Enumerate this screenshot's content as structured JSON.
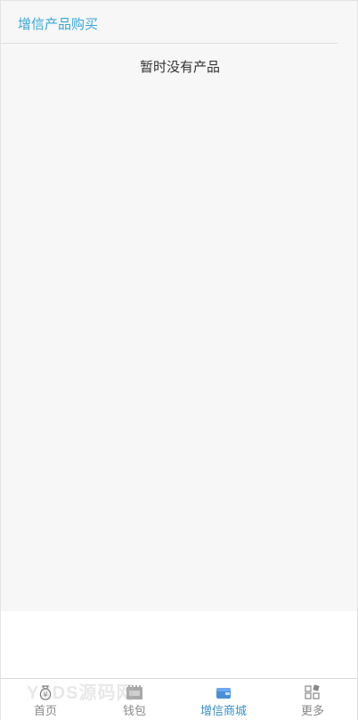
{
  "header": {
    "title": "增信产品购买"
  },
  "main": {
    "empty_message": "暂时没有产品"
  },
  "tabbar": {
    "items": [
      {
        "label": "首页",
        "icon": "money-bag-icon",
        "active": false
      },
      {
        "label": "钱包",
        "icon": "wallet-icon",
        "active": false
      },
      {
        "label": "增信商城",
        "icon": "mall-icon",
        "active": true
      },
      {
        "label": "更多",
        "icon": "more-grid-icon",
        "active": false
      }
    ]
  },
  "watermark": {
    "text": "YXDS源码网"
  },
  "colors": {
    "accent": "#38a7d9",
    "active_tab": "#3a8fc9",
    "inactive_tab": "#888888",
    "background": "#f7f7f7"
  }
}
